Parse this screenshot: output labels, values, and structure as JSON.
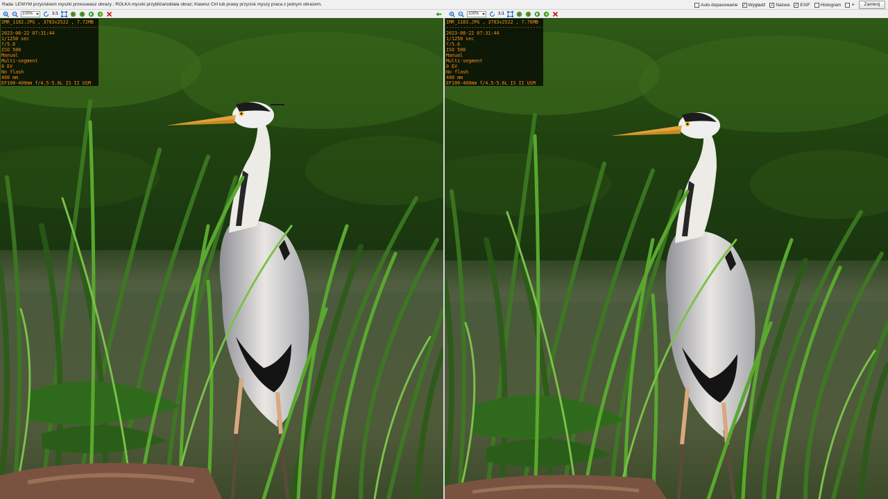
{
  "hint": "Rada: LEWYM przyciskiem myszki przesuwasz obrazy ; ROLKA myszki przybliża/oddala obraz; Klawisz Ctrl lub prawy przycisk myszy praca z jednym obrazem.",
  "options": [
    {
      "label": "Auto dopasowanie",
      "checked": false
    },
    {
      "label": "Wygładź",
      "checked": true
    },
    {
      "label": "Nazwa",
      "checked": true
    },
    {
      "label": "EXIF",
      "checked": true
    },
    {
      "label": "Histogram",
      "checked": false
    }
  ],
  "close_label": "Zamknij",
  "plus_label": "+",
  "toolbar": {
    "zoom": "100%",
    "one_to_one": "1:1"
  },
  "icons": {
    "zoom_in": "zoom-in-icon",
    "zoom_out": "zoom-out-icon",
    "refresh": "refresh-icon",
    "fit": "fit-icon",
    "rotate_left": "rotate-left-icon",
    "rotate_right": "rotate-right-icon",
    "prev": "prev-icon",
    "next": "next-icon",
    "delete": "delete-icon",
    "swap": "swap-arrow-icon"
  },
  "colors": {
    "exif_text": "#ff8f1a",
    "delete": "#cc1111",
    "nav": "#2a9a2a",
    "zoom": "#2a6fcc"
  },
  "left": {
    "filename_line": "IMR_1182.JPG , 3783x2522 , 7.72MB",
    "separator": "-----------------------------------------",
    "exif": [
      "2023-08-22 07:31:44",
      "1/1250 sec",
      "f/5.6",
      "ISO 500",
      "Manual",
      "Multi-segment",
      "0 EV",
      "No flash",
      "400 mm",
      "EF100-400mm f/4.5-5.6L IS II USM"
    ]
  },
  "right": {
    "filename_line": "IMR_1183.JPG , 3783x2522 , 7.76MB",
    "separator": "-----------------------------------------",
    "exif": [
      "2023-08-22 07:31:44",
      "1/1250 sec",
      "f/5.6",
      "ISO 500",
      "Manual",
      "Multi-segment",
      "0 EV",
      "No flash",
      "400 mm",
      "EF100-400mm f/4.5-5.6L IS II USM"
    ]
  }
}
